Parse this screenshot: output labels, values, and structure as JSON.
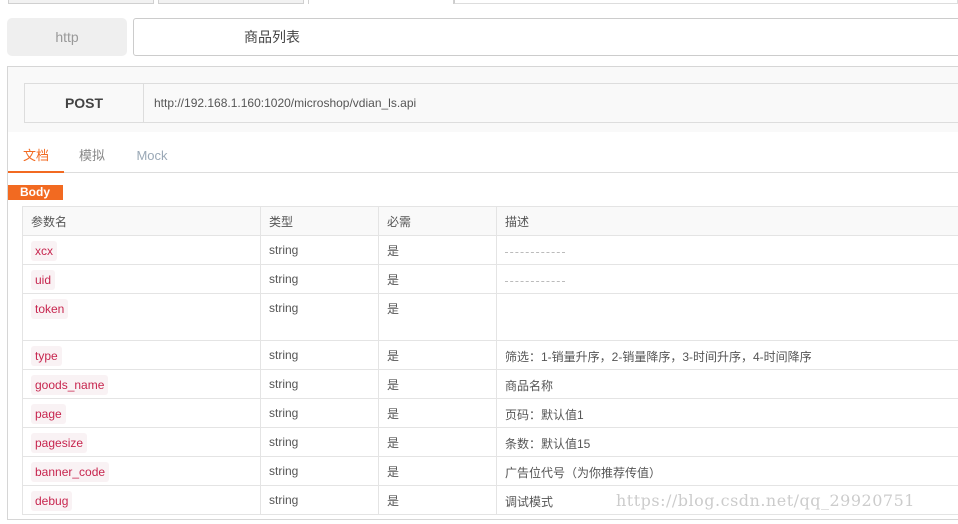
{
  "name_row": {
    "protocol": "http",
    "api_name": "商品列表"
  },
  "request": {
    "method": "POST",
    "url": "http://192.168.1.160:1020/microshop/vdian_ls.api"
  },
  "doc_tabs": [
    {
      "label": "文档",
      "active": true
    },
    {
      "label": "模拟",
      "active": false
    },
    {
      "label": "Mock",
      "active": false
    }
  ],
  "body_badge": "Body",
  "colors": {
    "accent": "#f26a21",
    "param_name_text": "#c7254e",
    "param_name_bg": "#f9f2f4"
  },
  "params_table": {
    "headers": [
      "参数名",
      "类型",
      "必需",
      "描述"
    ],
    "rows": [
      {
        "name": "xcx",
        "type": "string",
        "required": "是",
        "description": ""
      },
      {
        "name": "uid",
        "type": "string",
        "required": "是",
        "description": ""
      },
      {
        "name": "token",
        "type": "string",
        "required": "是",
        "description": ""
      },
      {
        "name": "type",
        "type": "string",
        "required": "是",
        "description": "筛选：1-销量升序，2-销量降序，3-时间升序，4-时间降序"
      },
      {
        "name": "goods_name",
        "type": "string",
        "required": "是",
        "description": "商品名称"
      },
      {
        "name": "page",
        "type": "string",
        "required": "是",
        "description": "页码：默认值1"
      },
      {
        "name": "pagesize",
        "type": "string",
        "required": "是",
        "description": "条数：默认值15"
      },
      {
        "name": "banner_code",
        "type": "string",
        "required": "是",
        "description": "广告位代号（为你推荐传值）"
      },
      {
        "name": "debug",
        "type": "string",
        "required": "是",
        "description": "调试模式"
      }
    ]
  },
  "watermark": "https://blog.csdn.net/qq_29920751"
}
